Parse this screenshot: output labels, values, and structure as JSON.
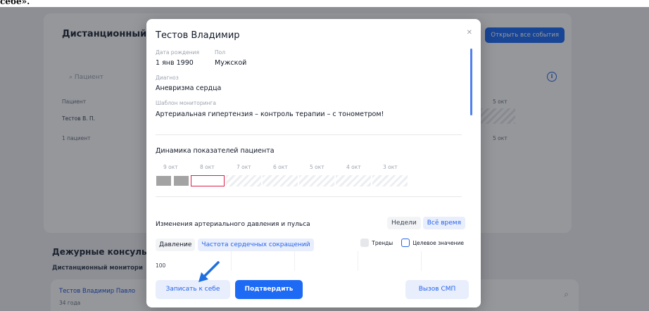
{
  "caption": "себе».",
  "background": {
    "monitor_title": "Дистанционный мо",
    "open_all_label": "Открыть все события",
    "search_placeholder": "Пациент",
    "col_patient": "Пациент",
    "row_patient": "Тестов В. П.",
    "row_count": "1 пациент",
    "date_a": "5 окт",
    "date_b": "5 окт",
    "duty_title": "Дежурные консульта",
    "duty_sub": "Дистанционный монитори",
    "patient_name": "Тестов Владимир Павло",
    "patient_age": "34 года"
  },
  "modal": {
    "title": "Тестов Владимир",
    "birth_label": "Дата рождения",
    "birth_value": "1 янв 1990",
    "sex_label": "Пол",
    "sex_value": "Мужской",
    "diagnosis_label": "Диагноз",
    "diagnosis_value": "Аневризма сердца",
    "template_label": "Шаблон мониторинга",
    "template_value": "Артериальная гипертензия – контроль терапии – с тонометром!",
    "dynamics_title": "Динамика показателей пациента",
    "dates": [
      "9 окт",
      "8 окт",
      "7 окт",
      "6 окт",
      "5 окт",
      "4 окт",
      "3 окт"
    ],
    "bp_title": "Изменения артериального давления и пульса",
    "period_options": [
      "Недели",
      "Всё время"
    ],
    "period_selected": "Всё время",
    "tab_pressure": "Давление",
    "tab_hr": "Частота сердечных сокращений",
    "trends_label": "Тренды",
    "target_label": "Целевое значение",
    "y_tick": "100",
    "btn_record": "Записать к себе",
    "btn_confirm": "Подтвердить",
    "btn_smp": "Вызов СМП"
  },
  "colors": {
    "accent": "#1d6af5",
    "selected_cell": "#e11d48"
  }
}
